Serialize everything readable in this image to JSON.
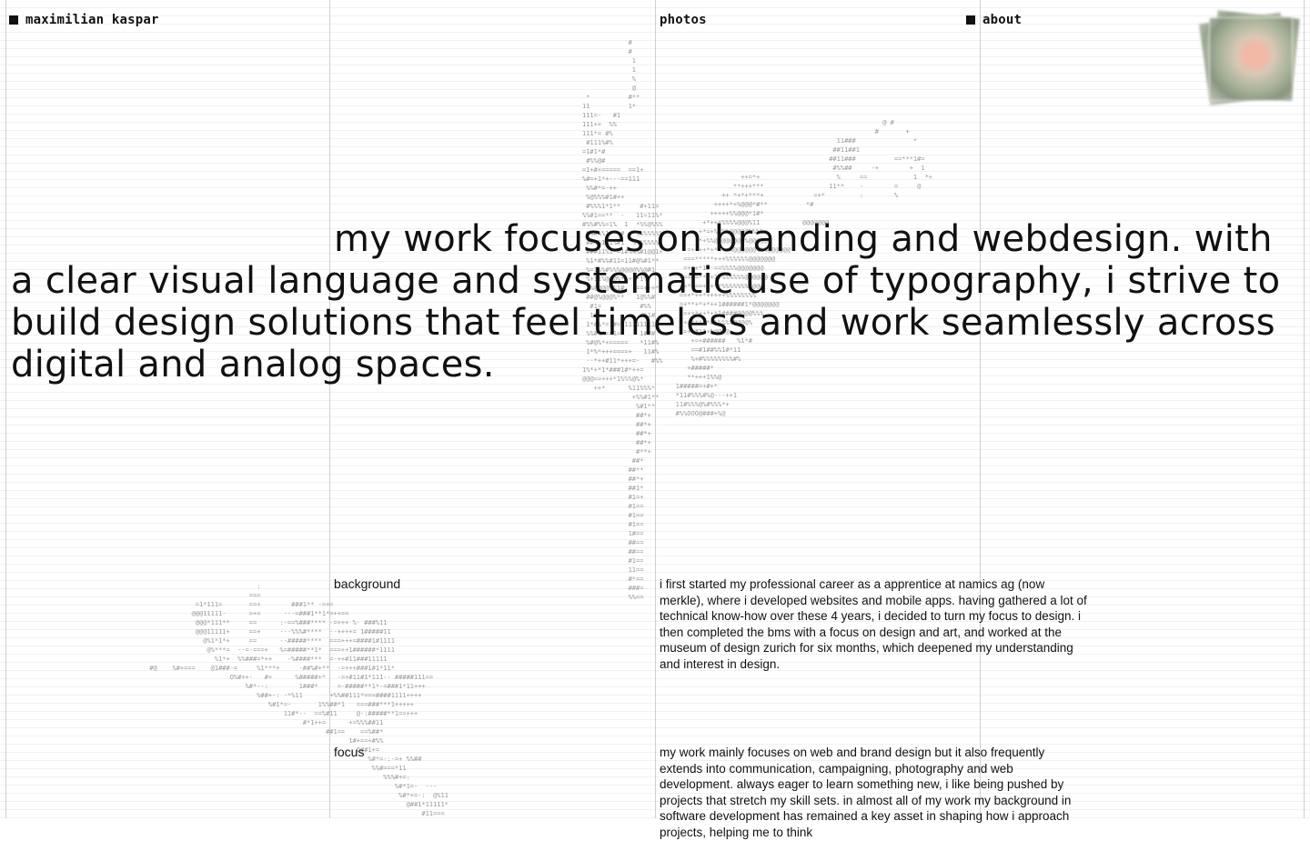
{
  "header": {
    "name": "maximilian kaspar",
    "nav": {
      "photos": "photos",
      "about": "about"
    }
  },
  "intro": {
    "text": "my work focuses on branding and webdesign. with a clear visual language and systematic use of typography, i strive to build design solutions that feel timeless and work seamlessly across digital and analog spaces."
  },
  "sections": {
    "background": {
      "label": "background",
      "text": "i first started my professional career as a apprentice at namics ag (now merkle), where i developed websites and mobile apps. having gathered a lot of technical know-how over these 4 years, i decided to turn my focus to design. i then completed the bms with a focus on design and art, and worked at the museum of design zurich for six months, which deepened my understanding and interest in design."
    },
    "focus": {
      "label": "focus",
      "text": "my work mainly focuses on web and brand design but it also frequently extends into communication, campaigning, photography and web development. always eager to learn something new, i like being pushed by projects that stretch my skill sets. in almost all of my work my background in software development has remained a key asset in shaping how i approach projects, helping me to think"
    }
  },
  "colors": {
    "text": "#111111",
    "ascii": "#9a9a9a",
    "grid": "#cfcfcf"
  }
}
